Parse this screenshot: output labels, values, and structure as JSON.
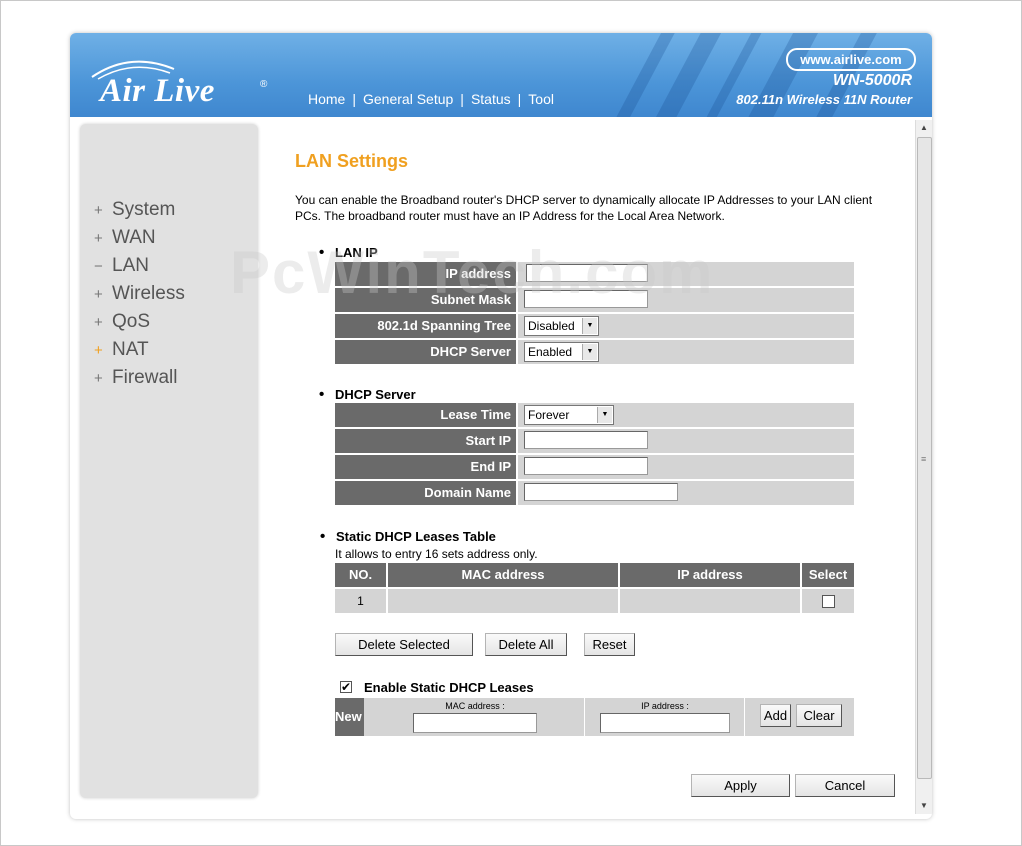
{
  "header": {
    "logo_text": "Air Live",
    "logo_reg": "®",
    "url_badge": "www.airlive.com",
    "model": "WN-5000R",
    "model_sub": "802.11n Wireless 11N Router",
    "nav": [
      "Home",
      "General Setup",
      "Status",
      "Tool"
    ],
    "nav_sep": "|"
  },
  "sidebar": {
    "items": [
      {
        "prefix": "+",
        "label": "System"
      },
      {
        "prefix": "+",
        "label": "WAN"
      },
      {
        "prefix": "−",
        "label": "LAN"
      },
      {
        "prefix": "+",
        "label": "Wireless"
      },
      {
        "prefix": "+",
        "label": "QoS"
      },
      {
        "prefix": "+",
        "label": "NAT"
      },
      {
        "prefix": "+",
        "label": "Firewall"
      }
    ]
  },
  "watermark": "PcWinTech.com",
  "main": {
    "title": "LAN Settings",
    "description": "You can enable the Broadband router's DHCP server to dynamically allocate IP Addresses to your LAN client PCs. The broadband router must have an IP Address for the Local Area Network.",
    "lan_ip": {
      "heading": "LAN IP",
      "ip_address_label": "IP address",
      "ip_address_value": "",
      "subnet_mask_label": "Subnet Mask",
      "subnet_mask_value": "",
      "spanning_tree_label": "802.1d Spanning Tree",
      "spanning_tree_value": "Disabled",
      "dhcp_server_label": "DHCP Server",
      "dhcp_server_value": "Enabled"
    },
    "dhcp": {
      "heading": "DHCP Server",
      "lease_time_label": "Lease Time",
      "lease_time_value": "Forever",
      "start_ip_label": "Start IP",
      "start_ip_value": "",
      "end_ip_label": "End IP",
      "end_ip_value": "",
      "domain_name_label": "Domain Name",
      "domain_name_value": ""
    },
    "static": {
      "heading": "Static DHCP Leases Table",
      "note": "It allows to entry 16 sets address only.",
      "columns": [
        "NO.",
        "MAC address",
        "IP address",
        "Select"
      ],
      "rows": [
        {
          "no": "1",
          "mac": "",
          "ip": "",
          "selected": false
        }
      ],
      "delete_selected": "Delete Selected",
      "delete_all": "Delete All",
      "reset": "Reset",
      "enable_label": "Enable Static DHCP Leases",
      "enable_checked": true,
      "new_label": "New",
      "mac_field_label": "MAC address :",
      "ip_field_label": "IP address :",
      "add": "Add",
      "clear": "Clear"
    },
    "apply": "Apply",
    "cancel": "Cancel"
  }
}
